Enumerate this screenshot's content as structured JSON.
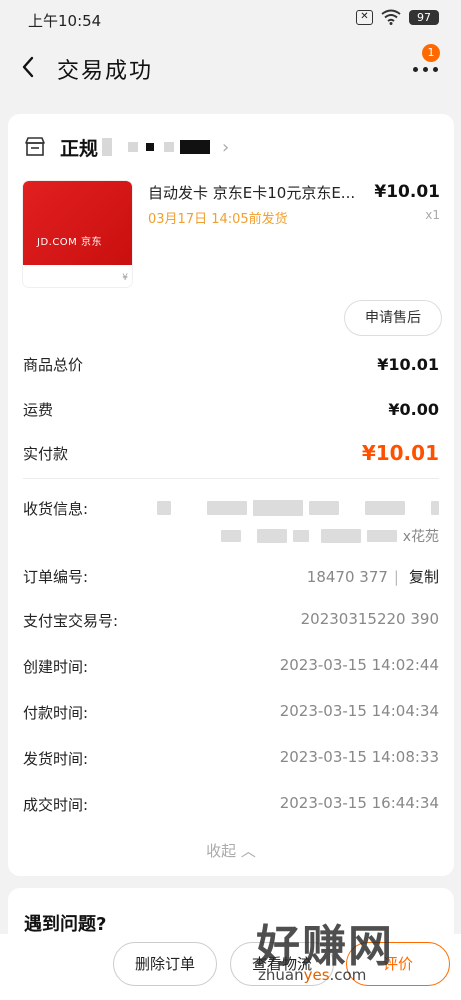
{
  "status_bar": {
    "time": "上午10:54",
    "battery": "97",
    "close_glyph": "✕"
  },
  "nav": {
    "title": "交易成功",
    "back_glyph": "‹",
    "badge_count": "1"
  },
  "shop": {
    "name_prefix": "正规"
  },
  "product": {
    "title": "自动发卡 京东E卡10元京东E...",
    "ship_text": "03月17日 14:05前发货",
    "price": "¥10.01",
    "qty": "x1",
    "image_logo": "JD.COM 京东",
    "image_yen": "¥"
  },
  "after_sale_button": "申请售后",
  "prices": {
    "goods_total_label": "商品总价",
    "goods_total_value": "¥10.01",
    "shipping_label": "运费",
    "shipping_value": "¥0.00",
    "paid_label": "实付款",
    "paid_value": "¥10.01"
  },
  "info": {
    "address_label": "收货信息:",
    "address_tail": "x花苑",
    "order_no_label": "订单编号:",
    "order_no_value": "18470   377",
    "copy_label": "复制",
    "alipay_label": "支付宝交易号:",
    "alipay_value": "20230315220    390",
    "created_label": "创建时间:",
    "created_value": "2023-03-15 14:02:44",
    "paid_label": "付款时间:",
    "paid_value": "2023-03-15 14:04:34",
    "shipped_label": "发货时间:",
    "shipped_value": "2023-03-15 14:08:33",
    "closed_label": "成交时间:",
    "closed_value": "2023-03-15 16:44:34"
  },
  "collapse_label": "收起 ︿",
  "problem_title": "遇到问题?",
  "bottom_bar": {
    "delete_label": "删除订单",
    "logistics_label": "查看物流",
    "review_label": "评价"
  },
  "watermark": {
    "big": "好赚网",
    "small_a": "zhuan",
    "small_b": "yes",
    "small_c": ".com"
  },
  "colors": {
    "accent": "#ff5000",
    "ship_text": "#f0a030",
    "badge": "#ff6a00"
  }
}
